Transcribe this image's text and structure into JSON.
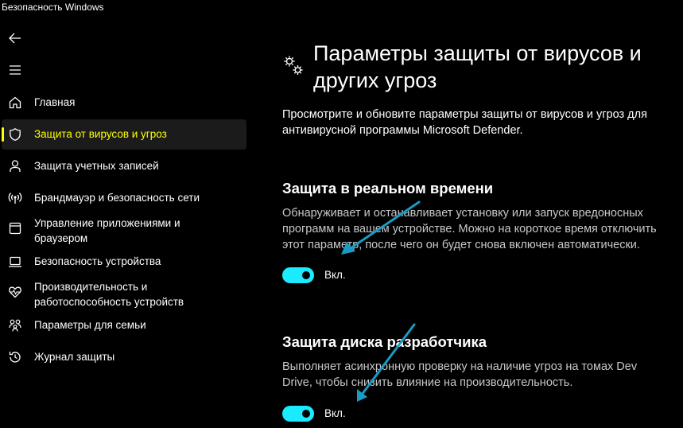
{
  "window": {
    "title": "Безопасность Windows"
  },
  "colors": {
    "background": "#000000",
    "accent_active": "#ffff00",
    "toggle_on": "#1aebff",
    "annotation_arrow": "#1a9bc4"
  },
  "nav": {
    "back_icon": "back-arrow-icon",
    "menu_icon": "hamburger-menu-icon",
    "items": [
      {
        "label": "Главная",
        "icon": "home-icon",
        "active": false
      },
      {
        "label": "Защита от вирусов и угроз",
        "icon": "shield-icon",
        "active": true
      },
      {
        "label": "Защита учетных записей",
        "icon": "person-icon",
        "active": false
      },
      {
        "label": "Брандмауэр и безопасность сети",
        "icon": "wifi-broadcast-icon",
        "active": false
      },
      {
        "label": "Управление приложениями и браузером",
        "icon": "browser-window-icon",
        "active": false
      },
      {
        "label": "Безопасность устройства",
        "icon": "laptop-icon",
        "active": false
      },
      {
        "label": "Производительность и работоспособность устройств",
        "icon": "heart-pulse-icon",
        "active": false
      },
      {
        "label": "Параметры для семьи",
        "icon": "family-icon",
        "active": false
      },
      {
        "label": "Журнал защиты",
        "icon": "history-icon",
        "active": false
      }
    ]
  },
  "main": {
    "header_icon": "gears-icon",
    "title": "Параметры защиты от вирусов и других угроз",
    "description": "Просмотрите и обновите параметры защиты от вирусов и угроз для антивирусной программы Microsoft Defender.",
    "sections": [
      {
        "title": "Защита в реальном времени",
        "description": "Обнаруживает и останавливает установку или запуск вредоносных программ на вашем устройстве. Можно на короткое время отключить этот параметр, после чего он будет снова включен автоматически.",
        "toggle_on": true,
        "toggle_label": "Вкл."
      },
      {
        "title": "Защита диска разработчика",
        "description": "Выполняет асинхронную проверку на наличие угроз на томах Dev Drive, чтобы снизить влияние на производительность.",
        "toggle_on": true,
        "toggle_label": "Вкл."
      }
    ]
  }
}
